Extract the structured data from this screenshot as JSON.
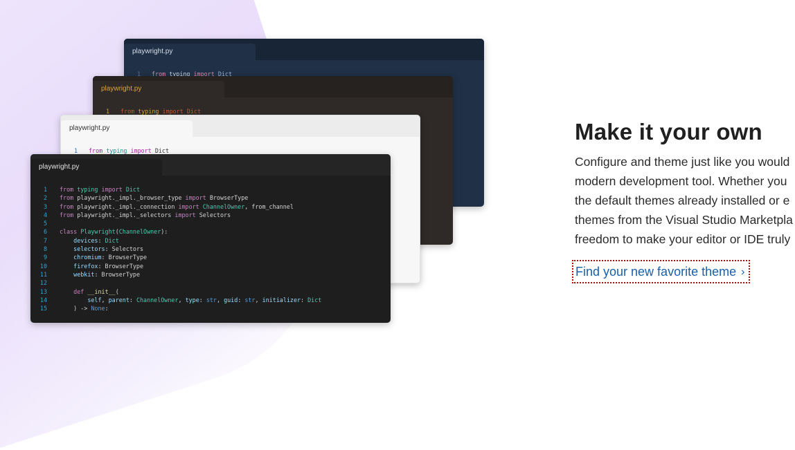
{
  "windows": [
    {
      "tab_label": "playwright.py",
      "line": "1",
      "code": "from typing import Dict"
    },
    {
      "tab_label": "playwright.py",
      "line": "1",
      "code": "from typing import Dict"
    },
    {
      "tab_label": "playwright.py",
      "line": "1",
      "code": "from typing import Dict"
    },
    {
      "tab_label": "playwright.py"
    }
  ],
  "code_lines": [
    {
      "n": "1",
      "t": "from typing import Dict"
    },
    {
      "n": "2",
      "t": "from playwright._impl._browser_type import BrowserType"
    },
    {
      "n": "3",
      "t": "from playwright._impl._connection import ChannelOwner, from_channel"
    },
    {
      "n": "4",
      "t": "from playwright._impl._selectors import Selectors"
    },
    {
      "n": "5",
      "t": ""
    },
    {
      "n": "6",
      "t": "class Playwright(ChannelOwner):"
    },
    {
      "n": "7",
      "t": "    devices: Dict"
    },
    {
      "n": "8",
      "t": "    selectors: Selectors"
    },
    {
      "n": "9",
      "t": "    chromium: BrowserType"
    },
    {
      "n": "10",
      "t": "    firefox: BrowserType"
    },
    {
      "n": "11",
      "t": "    webkit: BrowserType"
    },
    {
      "n": "12",
      "t": ""
    },
    {
      "n": "13",
      "t": "    def __init__("
    },
    {
      "n": "14",
      "t": "        self, parent: ChannelOwner, type: str, guid: str, initializer: Dict"
    },
    {
      "n": "15",
      "t": "    ) -> None:"
    }
  ],
  "headline": "Make it your own",
  "body_lines": [
    "Configure and theme just like you would",
    "modern development tool. Whether you",
    "the default themes already installed or e",
    "themes from the Visual Studio Marketpla",
    "freedom to make your editor or IDE truly"
  ],
  "cta_label": "Find your new favorite theme",
  "colors": {
    "accent_link": "#1a5fa8",
    "focus_outline": "#c00000",
    "headline": "#202020"
  }
}
